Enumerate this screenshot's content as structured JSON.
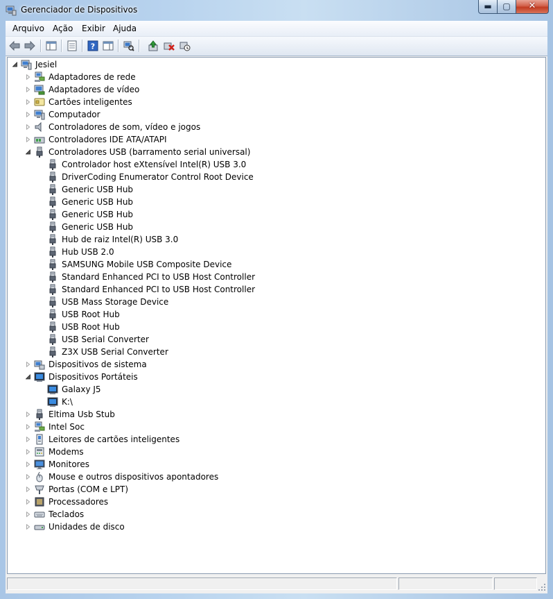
{
  "window": {
    "title": "Gerenciador de Dispositivos",
    "controls": {
      "minimize": "▬",
      "maximize": "▢",
      "close": "✕"
    }
  },
  "menubar": {
    "items": [
      {
        "label": "Arquivo"
      },
      {
        "label": "Ação"
      },
      {
        "label": "Exibir"
      },
      {
        "label": "Ajuda"
      }
    ]
  },
  "toolbar": {
    "buttons": [
      {
        "icon": "back-arrow-icon"
      },
      {
        "icon": "forward-arrow-icon"
      },
      {
        "icon": "show-hide-console-tree-icon"
      },
      {
        "icon": "properties-icon"
      },
      {
        "icon": "help-icon"
      },
      {
        "icon": "show-hide-action-pane-icon"
      },
      {
        "icon": "scan-hardware-icon"
      },
      {
        "icon": "update-driver-icon"
      },
      {
        "icon": "uninstall-device-icon"
      },
      {
        "icon": "disable-device-icon"
      }
    ]
  },
  "tree": {
    "root": {
      "label": "Jesiel",
      "icon": "computer-icon",
      "expanded": true
    },
    "categories": [
      {
        "label": "Adaptadores de rede",
        "icon": "network-adapter-icon",
        "expanded": false,
        "children": []
      },
      {
        "label": "Adaptadores de vídeo",
        "icon": "display-adapter-icon",
        "expanded": false,
        "children": []
      },
      {
        "label": "Cartões inteligentes",
        "icon": "smart-card-icon",
        "expanded": false,
        "children": []
      },
      {
        "label": "Computador",
        "icon": "computer-icon",
        "expanded": false,
        "children": []
      },
      {
        "label": "Controladores de som, vídeo e jogos",
        "icon": "speaker-icon",
        "expanded": false,
        "children": []
      },
      {
        "label": "Controladores IDE ATA/ATAPI",
        "icon": "ide-controller-icon",
        "expanded": false,
        "children": []
      },
      {
        "label": "Controladores USB (barramento serial universal)",
        "icon": "usb-icon",
        "expanded": true,
        "children": [
          "Controlador host eXtensível Intel(R) USB 3.0",
          "DriverCoding Enumerator Control Root Device",
          "Generic USB Hub",
          "Generic USB Hub",
          "Generic USB Hub",
          "Generic USB Hub",
          "Hub de raiz Intel(R) USB 3.0",
          "Hub USB 2.0",
          "SAMSUNG Mobile USB Composite Device",
          "Standard Enhanced PCI to USB Host Controller",
          "Standard Enhanced PCI to USB Host Controller",
          "USB Mass Storage Device",
          "USB Root Hub",
          "USB Root Hub",
          "USB Serial Converter",
          "Z3X USB Serial Converter"
        ]
      },
      {
        "label": "Dispositivos de sistema",
        "icon": "system-device-icon",
        "expanded": false,
        "children": []
      },
      {
        "label": "Dispositivos Portáteis",
        "icon": "portable-device-icon",
        "expanded": true,
        "children": [
          "Galaxy J5",
          "K:\\"
        ]
      },
      {
        "label": "Eltima Usb Stub",
        "icon": "usb-icon",
        "expanded": false,
        "children": []
      },
      {
        "label": "Intel Soc",
        "icon": "network-adapter-icon",
        "expanded": false,
        "children": []
      },
      {
        "label": "Leitores de cartões inteligentes",
        "icon": "card-reader-icon",
        "expanded": false,
        "children": []
      },
      {
        "label": "Modems",
        "icon": "modem-icon",
        "expanded": false,
        "children": []
      },
      {
        "label": "Monitores",
        "icon": "monitor-icon",
        "expanded": false,
        "children": []
      },
      {
        "label": "Mouse e outros dispositivos apontadores",
        "icon": "mouse-icon",
        "expanded": false,
        "children": []
      },
      {
        "label": "Portas (COM e LPT)",
        "icon": "port-icon",
        "expanded": false,
        "children": []
      },
      {
        "label": "Processadores",
        "icon": "processor-icon",
        "expanded": false,
        "children": []
      },
      {
        "label": "Teclados",
        "icon": "keyboard-icon",
        "expanded": false,
        "children": []
      },
      {
        "label": "Unidades de disco",
        "icon": "disk-drive-icon",
        "expanded": false,
        "children": []
      }
    ]
  },
  "colors": {
    "tree_background": "#ffffff",
    "client_background": "#f0f0f0",
    "titlebar_glass": "#b8d3ee",
    "close_button": "#c94a30"
  }
}
